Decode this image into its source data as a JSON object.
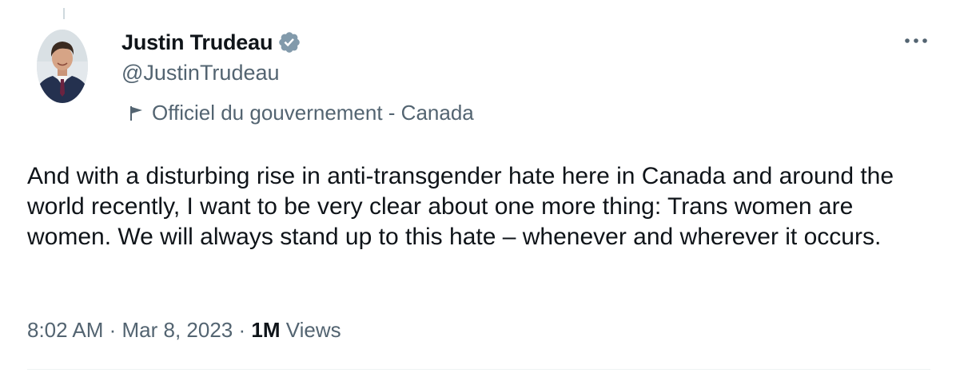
{
  "author": {
    "name": "Justin Trudeau",
    "handle": "@JustinTrudeau",
    "verified_badge_icon": "verified-badge-icon",
    "verified_badge_color": "#829aab"
  },
  "affiliation": {
    "icon": "flag-icon",
    "label": "Officiel du gouvernement - Canada"
  },
  "more_icon": "more-icon",
  "tweet": {
    "text": "And with a disturbing rise in anti-transgender hate here in Canada and around the world recently, I want to be very clear about one more thing: Trans women are women. We will always stand up to this hate – whenever and wherever it occurs."
  },
  "meta": {
    "time": "8:02 AM",
    "separator": " · ",
    "date": "Mar 8, 2023",
    "views_count": "1M",
    "views_label": " Views"
  },
  "colors": {
    "text_primary": "#0f1419",
    "text_secondary": "#536471",
    "divider": "#eff3f4"
  }
}
